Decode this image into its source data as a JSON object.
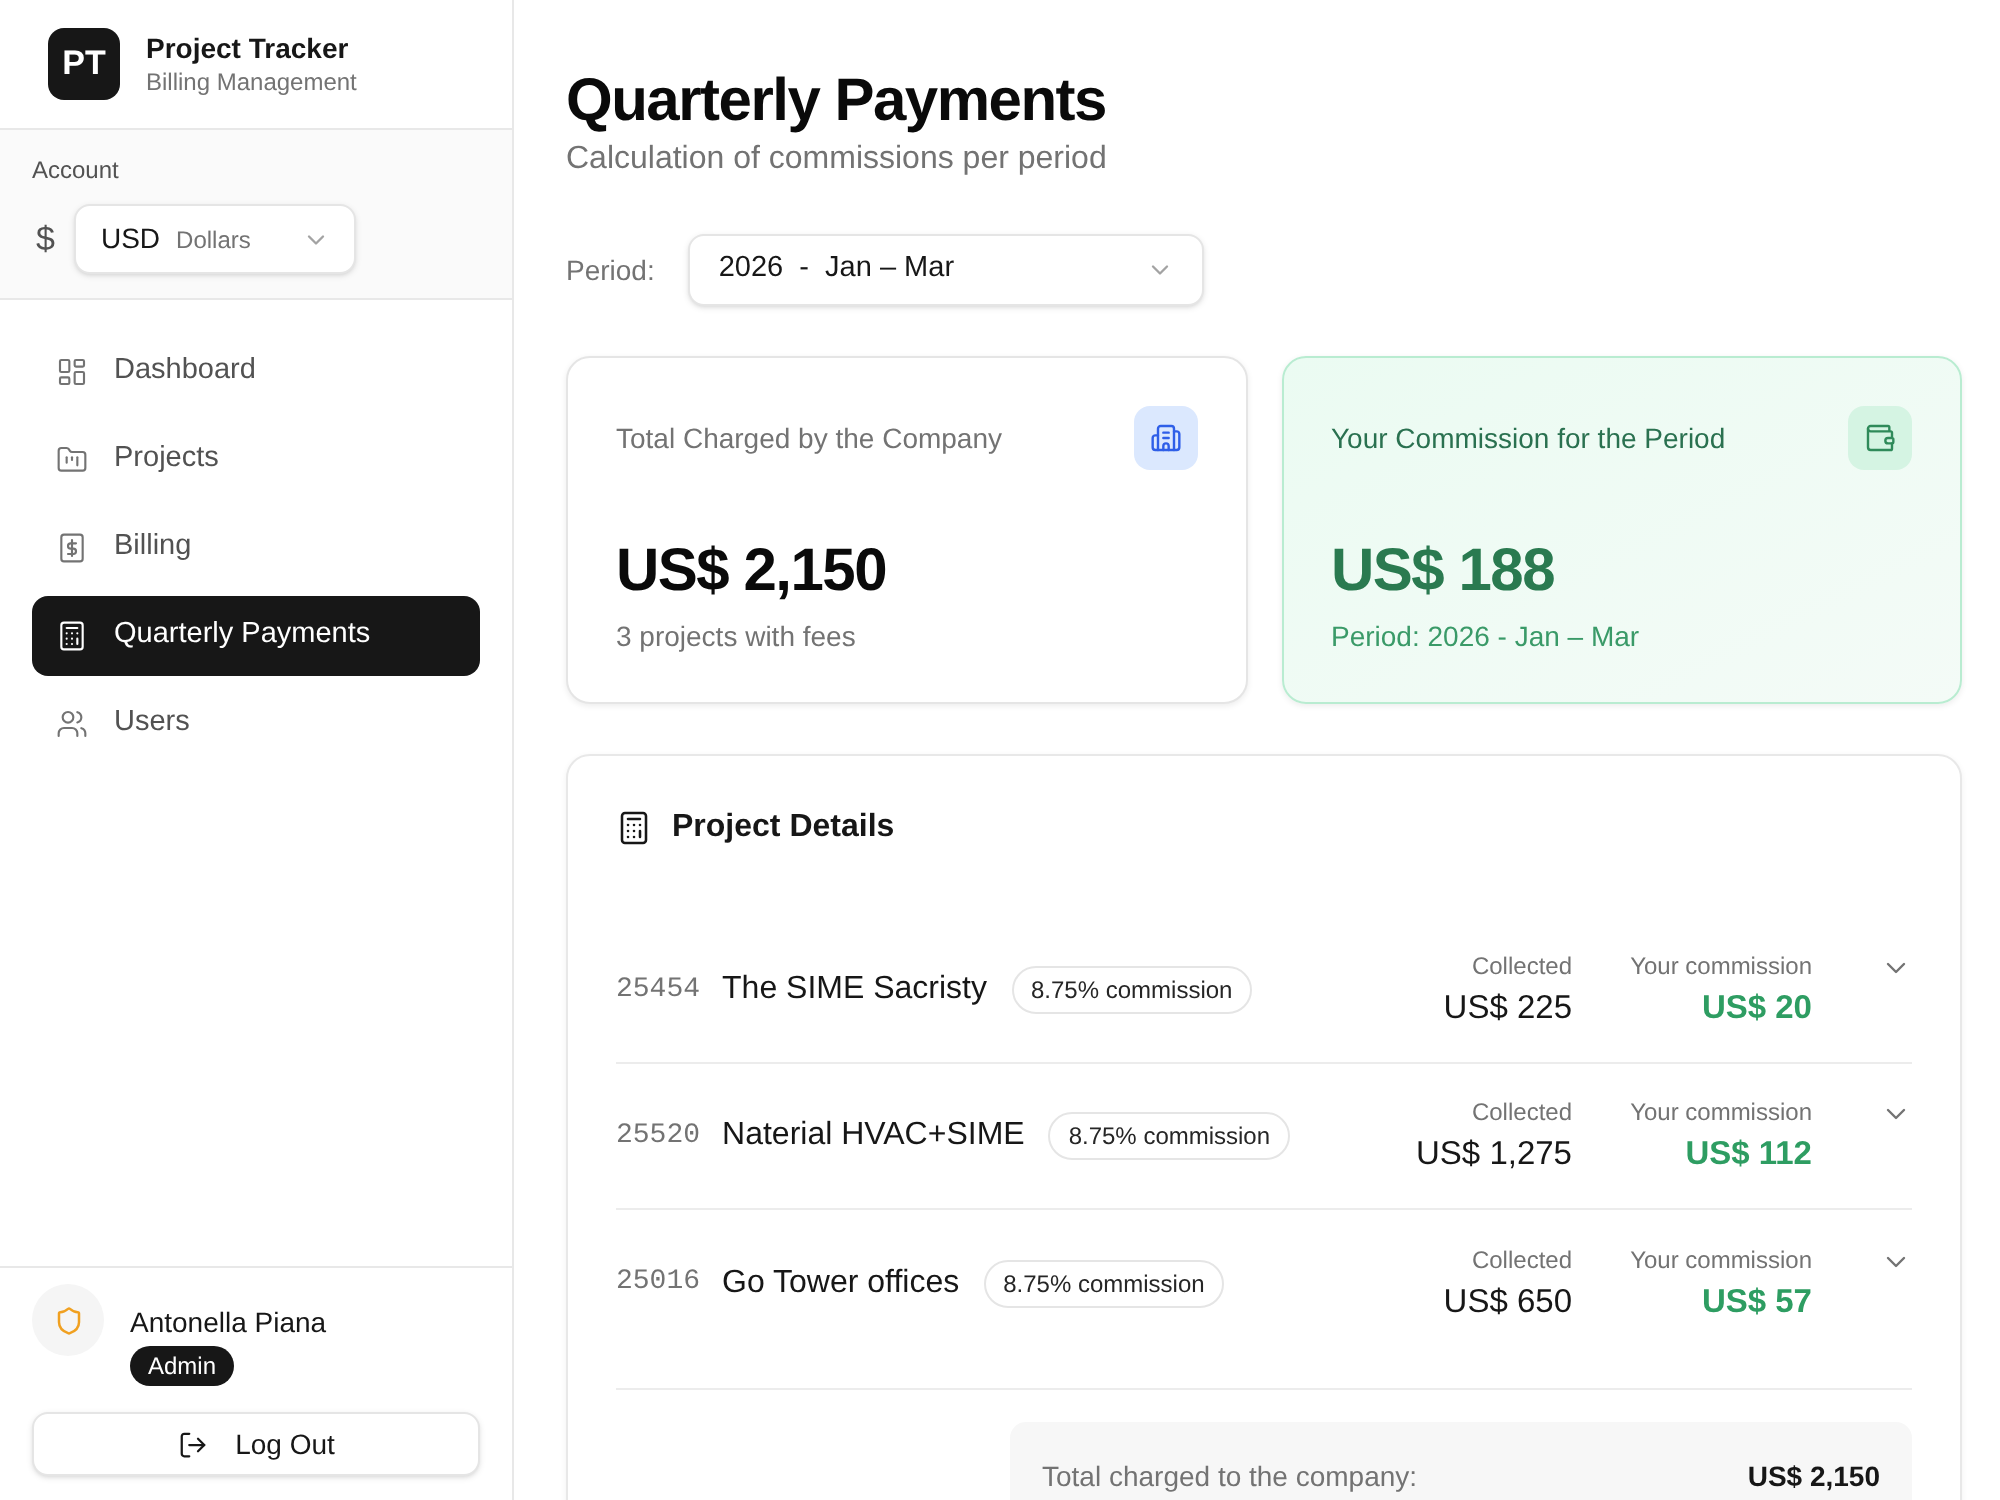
{
  "sidebar": {
    "logo": "PT",
    "app_name": "Project Tracker",
    "app_subtitle": "Billing Management",
    "account": {
      "label": "Account",
      "currency_symbol": "$",
      "currency_code": "USD",
      "currency_name": "Dollars"
    },
    "nav": [
      {
        "label": "Dashboard",
        "selected": false
      },
      {
        "label": "Projects",
        "selected": false
      },
      {
        "label": "Billing",
        "selected": false
      },
      {
        "label": "Quarterly Payments",
        "selected": true
      },
      {
        "label": "Users",
        "selected": false
      }
    ],
    "user": {
      "name": "Antonella Piana",
      "role": "Admin"
    },
    "logout": "Log Out"
  },
  "header": {
    "title": "Quarterly Payments",
    "subtitle": "Calculation of commissions per period"
  },
  "period": {
    "label": "Period:",
    "value": "2026  -  Jan – Mar"
  },
  "cards": [
    {
      "kind": "neutral",
      "title": "Total Charged by the Company",
      "value": "US$ 2,150",
      "note": "3 projects with fees"
    },
    {
      "kind": "highlight",
      "title": "Your Commission for the Period",
      "value": "US$ 188",
      "note": "Period: 2026 - Jan – Mar"
    }
  ],
  "details": {
    "title": "Project Details",
    "projects": [
      {
        "code": "25454",
        "name": "The SIME Sacristy",
        "badge": "8.75% commission",
        "collected_label": "Collected",
        "collected": "US$ 225",
        "commission_label": "Your commission",
        "commission": "US$ 20",
        "expanded": false
      },
      {
        "code": "25520",
        "name": "Naterial HVAC+SIME",
        "badge": "8.75% commission",
        "collected_label": "Collected",
        "collected": "US$ 1,275",
        "commission_label": "Your commission",
        "commission": "US$ 112",
        "expanded": false
      },
      {
        "code": "25016",
        "name": "Go Tower offices",
        "badge": "8.75% commission",
        "collected_label": "Collected",
        "collected": "US$ 650",
        "commission_label": "Your commission",
        "commission": "US$ 57",
        "expanded": false
      }
    ],
    "total": {
      "label": "Total charged to the company:",
      "value": "US$ 2,150"
    }
  }
}
